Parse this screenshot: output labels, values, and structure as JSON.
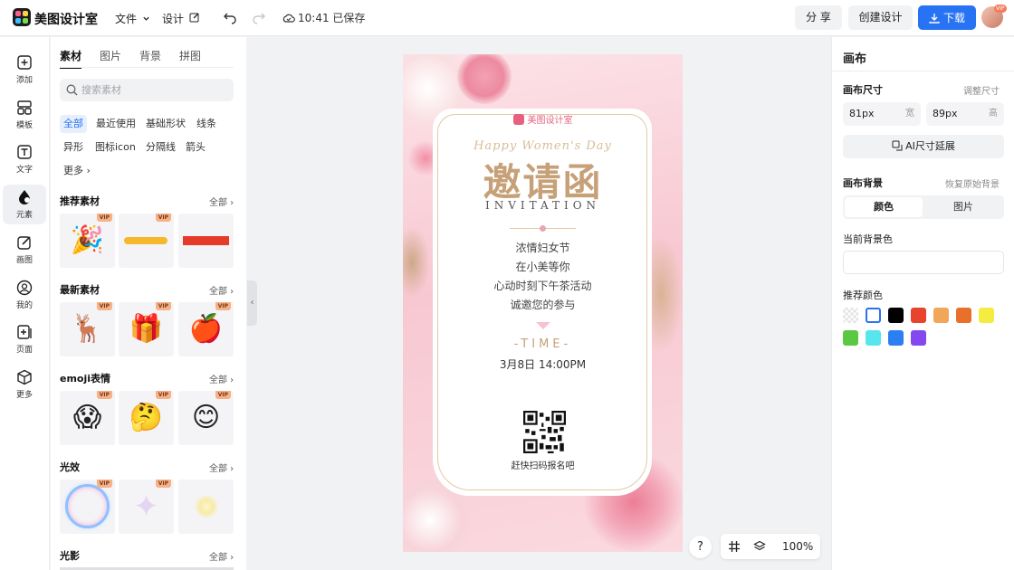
{
  "app": {
    "name": "美图设计室"
  },
  "topbar": {
    "file_menu": "文件",
    "design_menu": "设计",
    "save_status": "10:41 已保存",
    "share_label": "分 享",
    "create_label": "创建设计",
    "download_label": "下载",
    "avatar_badge": "VIP"
  },
  "rail": {
    "items": [
      {
        "label": "添加",
        "icon": "plus-square-icon"
      },
      {
        "label": "模板",
        "icon": "template-icon"
      },
      {
        "label": "文字",
        "icon": "text-icon"
      },
      {
        "label": "元素",
        "icon": "shapes-icon"
      },
      {
        "label": "画图",
        "icon": "draw-icon"
      },
      {
        "label": "我的",
        "icon": "user-icon"
      },
      {
        "label": "页面",
        "icon": "page-add-icon"
      },
      {
        "label": "更多",
        "icon": "cube-icon"
      }
    ]
  },
  "assets": {
    "tabs": [
      "素材",
      "图片",
      "背景",
      "拼图"
    ],
    "search_placeholder": "搜索素材",
    "chips": [
      "全部",
      "最近使用",
      "基础形状",
      "线条",
      "异形",
      "图标icon",
      "分隔线",
      "箭头",
      "更多"
    ],
    "view_all": "全部",
    "sections": [
      {
        "title": "推荐素材"
      },
      {
        "title": "最新素材"
      },
      {
        "title": "emoji表情"
      },
      {
        "title": "光效"
      },
      {
        "title": "光影"
      }
    ],
    "vip_label": "VIP"
  },
  "poster": {
    "brand": "美图设计室",
    "script_title": "Happy Women's Day",
    "title": "邀请函",
    "subtitle": "INVITATION",
    "lines": [
      "浓情妇女节",
      "在小美等你",
      "心动时刻下午茶活动",
      "诚邀您的参与"
    ],
    "time_heading": "-TIME-",
    "time_value": "3月8日 14:00PM",
    "qr_caption": "赶快扫码报名吧"
  },
  "canvas_controls": {
    "help": "?",
    "zoom": "100%"
  },
  "right_panel": {
    "title": "画布",
    "size_label": "画布尺寸",
    "adjust_size": "调整尺寸",
    "width_value": "81px",
    "width_unit": "宽",
    "height_value": "89px",
    "height_unit": "高",
    "ai_button": "AI尺寸延展",
    "bg_label": "画布背景",
    "restore_bg": "恢复原始背景",
    "seg_color": "颜色",
    "seg_image": "图片",
    "current_bg": "当前背景色",
    "recommended": "推荐颜色",
    "swatches": [
      "transparent",
      "#ffffff",
      "#000000",
      "#e8432c",
      "#f2a65a",
      "#e8702a",
      "#f5ec42",
      "#5bc843",
      "#56e6ec",
      "#2b7ff0",
      "#8448f0"
    ]
  }
}
